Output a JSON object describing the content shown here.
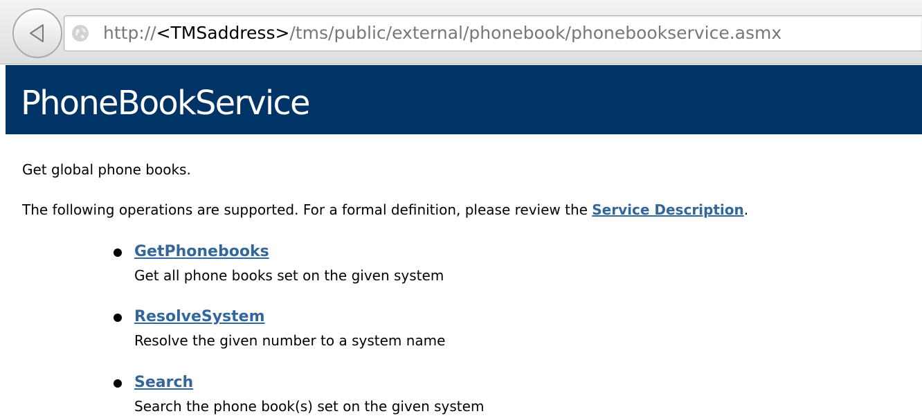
{
  "browser": {
    "url_prefix": "http://",
    "url_host": "<TMSaddress>",
    "url_path": "/tms/public/external/phonebook/phonebookservice.asmx",
    "back_icon": "back-arrow-icon",
    "site_icon": "globe-icon"
  },
  "page": {
    "title": "PhoneBookService",
    "description": "Get global phone books.",
    "operations_intro": "The following operations are supported. For a formal definition, please review the ",
    "service_description_link": "Service Description",
    "operations_intro_end": "."
  },
  "operations": [
    {
      "name": "GetPhonebooks",
      "description": "Get all phone books set on the given system"
    },
    {
      "name": "ResolveSystem",
      "description": "Resolve the given number to a system name"
    },
    {
      "name": "Search",
      "description": "Search the phone book(s) set on the given system"
    }
  ],
  "colors": {
    "header_background": "#003366",
    "link": "#336699",
    "header_text": "#ffffff"
  }
}
